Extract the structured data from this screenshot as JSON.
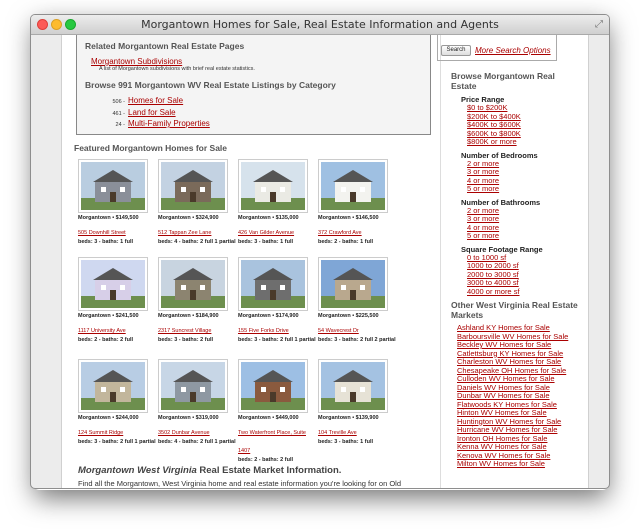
{
  "window": {
    "title": "Morgantown Homes for Sale, Real Estate Information and Agents"
  },
  "related": {
    "heading": "Related Morgantown Real Estate Pages",
    "subdivisions_link": "Morgantown Subdivisions",
    "subdivisions_note": "A list of Morgantown subdivisions with brief real estate statistics.",
    "browse_heading": "Browse 991 Morgantown WV Real Estate Listings by Category",
    "categories": [
      {
        "count": "506 -",
        "label": "Homes for Sale"
      },
      {
        "count": "461 -",
        "label": "Land for Sale"
      },
      {
        "count": "24 -",
        "label": "Multi-Family Properties"
      }
    ]
  },
  "featured": {
    "heading": "Featured Morgantown Homes for Sale",
    "listings": [
      {
        "price": "Morgantown • $149,500",
        "addr": "505 Downhill Street",
        "beds": "beds: 3 - baths: 1 full",
        "sky": "#b9cde0",
        "house": "#8a8f99"
      },
      {
        "price": "Morgantown • $324,900",
        "addr": "512 Tappan Zee Lane",
        "beds": "beds: 4 - baths: 2 full 1 partial",
        "sky": "#c3d2e2",
        "house": "#7a6a5a"
      },
      {
        "price": "Morgantown • $135,000",
        "addr": "426 Van Gilder Avenue",
        "beds": "beds: 3 - baths: 1 full",
        "sky": "#d6e2ec",
        "house": "#eaeae4"
      },
      {
        "price": "Morgantown • $146,500",
        "addr": "372 Crawford Ave",
        "beds": "beds: 2 - baths: 1 full",
        "sky": "#9fc0e2",
        "house": "#f3f3ef"
      },
      {
        "price": "Morgantown • $241,500",
        "addr": "1117 University Ave",
        "beds": "beds: 2 - baths: 2 full",
        "sky": "#cfd8f0",
        "house": "#d7cfe8"
      },
      {
        "price": "Morgantown • $184,900",
        "addr": "2317 Suncrest Village",
        "beds": "beds: 3 - baths: 2 full",
        "sky": "#c8d4e0",
        "house": "#8c8470"
      },
      {
        "price": "Morgantown • $174,900",
        "addr": "155 Five Forks Drive",
        "beds": "beds: 3 - baths: 2 full 1 partial",
        "sky": "#a9c3de",
        "house": "#6e6e6e"
      },
      {
        "price": "Morgantown • $225,500",
        "addr": "54 Wavecrest Dr",
        "beds": "beds: 3 - baths: 2 full 2 partial",
        "sky": "#7fa6d6",
        "house": "#b9a88e"
      },
      {
        "price": "Morgantown • $244,000",
        "addr": "124 Summit Ridge",
        "beds": "beds: 3 - baths: 2 full 1 partial",
        "sky": "#b8cde4",
        "house": "#c2b69c"
      },
      {
        "price": "Morgantown • $319,000",
        "addr": "3502 Dunbar Avenue",
        "beds": "beds: 4 - baths: 2 full 1 partial",
        "sky": "#c7d6e6",
        "house": "#8e98a2"
      },
      {
        "price": "Morgantown • $449,000",
        "addr": "Two Waterfront Place, Suite 1407",
        "beds": "beds: 2 - baths: 2 full",
        "sky": "#9dbfe4",
        "house": "#8a5a3e"
      },
      {
        "price": "Morgantown • $139,900",
        "addr": "104 Treville Ave",
        "beds": "beds: 3 - baths: 1 full",
        "sky": "#a4c2e2",
        "house": "#e6e2d6"
      }
    ]
  },
  "market": {
    "title_italic": "Morgantown West Virginia",
    "title_rest": " Real Estate Market Information.",
    "text": "Find all the Morgantown, West Virginia home and real estate information you're looking for on Old Colony Realtors's West Virginia real estate website, www.oldcolony.com. At www.oldcolony.com, you"
  },
  "sidebar": {
    "search_button": "Search",
    "more_search": "More Search Options",
    "browse_title": "Browse Morgantown Real Estate",
    "price_heading": "Price Range",
    "prices": [
      "$0 to $200K",
      "$200K to $400K",
      "$400K to $600K",
      "$600K to $800K",
      "$800K or more"
    ],
    "bed_heading": "Number of Bedrooms",
    "beds": [
      "2 or more",
      "3 or more",
      "4 or more",
      "5 or more"
    ],
    "bath_heading": "Number of Bathrooms",
    "baths": [
      "2 or more",
      "3 or more",
      "4 or more",
      "5 or more"
    ],
    "sqft_heading": "Square Footage Range",
    "sqft": [
      "0 to 1000 sf",
      "1000 to 2000 sf",
      "2000 to 3000 sf",
      "3000 to 4000 sf",
      "4000 or more sf"
    ],
    "markets_title": "Other West Virginia Real Estate Markets",
    "markets": [
      "Ashland KY Homes for Sale",
      "Barboursville WV Homes for Sale",
      "Beckley WV Homes for Sale",
      "Catlettsburg KY Homes for Sale",
      "Charleston WV Homes for Sale",
      "Chesapeake OH Homes for Sale",
      "Culloden WV Homes for Sale",
      "Daniels WV Homes for Sale",
      "Dunbar WV Homes for Sale",
      "Flatwoods KY Homes for Sale",
      "Hinton WV Homes for Sale",
      "Huntington WV Homes for Sale",
      "Hurricane WV Homes for Sale",
      "Ironton OH Homes for Sale",
      "Kenna WV Homes for Sale",
      "Kenova WV Homes for Sale",
      "Milton WV Homes for Sale"
    ]
  }
}
